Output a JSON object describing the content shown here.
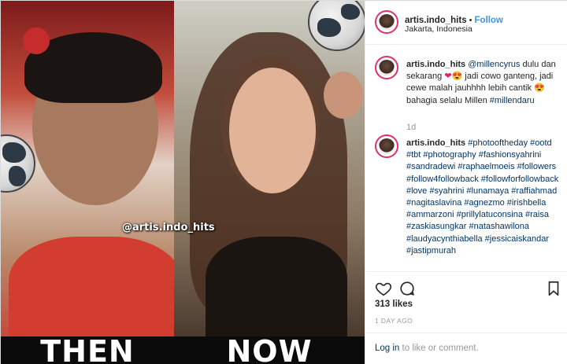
{
  "post": {
    "photo": {
      "left_caption": "THEN",
      "right_caption": "NOW",
      "watermark": "@artis.indo_hits"
    },
    "header": {
      "username": "artis.indo_hits",
      "separator": "•",
      "follow_label": "Follow",
      "location": "Jakarta, Indonesia"
    },
    "caption": {
      "username": "artis.indo_hits",
      "mention": "@millencyrus",
      "text_part1": " dulu dan sekarang ",
      "emoji1": "❤",
      "emoji2": "😍",
      "text_part2": " jadi cowo ganteng, jadi cewe malah jauhhhh lebih cantik ",
      "emoji3": "😍",
      "text_part3": " bahagia selalu Millen ",
      "hashtag": "#millendaru",
      "time": "1d"
    },
    "comment": {
      "username": "artis.indo_hits",
      "hashtags": "#photooftheday #ootd #tbt #photography #fashionsyahrini #sandradewi #raphaelmoeis #followers #follow4followback #followforfollowback #love #syahrini #lunamaya #raffiahmad #nagitaslavina #agnezmo #irishbella #ammarzoni #prillylatuconsina #raisa #zaskiasungkar #natashawilona #laudyacynthiabella #jessicaiskandar #jastipmurah"
    },
    "actions": {
      "like_icon": "heart-icon",
      "comment_icon": "comment-icon",
      "save_icon": "bookmark-icon"
    },
    "likes": "313 likes",
    "posted_ago": "1 DAY AGO",
    "login": {
      "link": "Log in",
      "text": " to like or comment."
    }
  },
  "colors": {
    "follow": "#3897f0",
    "hashtag": "#003569",
    "muted": "#999999",
    "avatar_ring": "#e1306c"
  }
}
